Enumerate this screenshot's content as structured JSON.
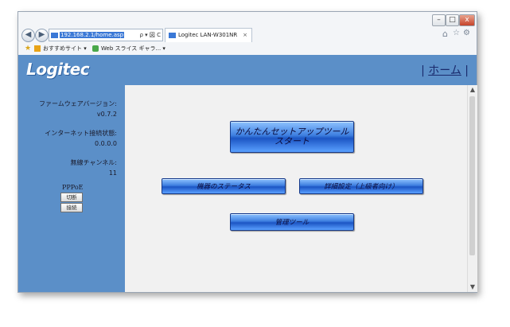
{
  "browser": {
    "address": "192.168.2.1/home.asp",
    "address_tools": "ρ ▾ 図 C",
    "tab_title": "Logitec LAN-W301NR",
    "tab_close": "×",
    "favorites": [
      {
        "label": "おすすめサイト ▾"
      },
      {
        "label": "Web スライス ギャラ... ▾"
      }
    ],
    "window_controls": [
      "–",
      "□",
      "x"
    ],
    "toolbar_icons": [
      "home-icon",
      "star-icon",
      "gear-icon"
    ]
  },
  "header": {
    "logo": "Logitec",
    "home_prefix": "| ",
    "home_link": "ホーム",
    "home_suffix": " |"
  },
  "sidebar": {
    "firmware_label": "ファームウェアバージョン:",
    "firmware_value": "v0.7.2",
    "internet_label": "インターネット接続状態:",
    "internet_value": "0.0.0.0",
    "channel_label": "無線チャンネル:",
    "channel_value": "11",
    "pppoe_label": "PPPoE",
    "disconnect_button": "切断",
    "connect_button": "接続"
  },
  "main": {
    "setup_button_line1": "かんたんセットアップツール",
    "setup_button_line2": "スタート",
    "status_button": "機器のステータス",
    "advanced_button": "詳細設定（上級者向け）",
    "admin_button": "管理ツール"
  },
  "colors": {
    "accent": "#5b8fc8",
    "button_blue": "#2e6ad6",
    "content_bg": "#f1f1f1"
  }
}
